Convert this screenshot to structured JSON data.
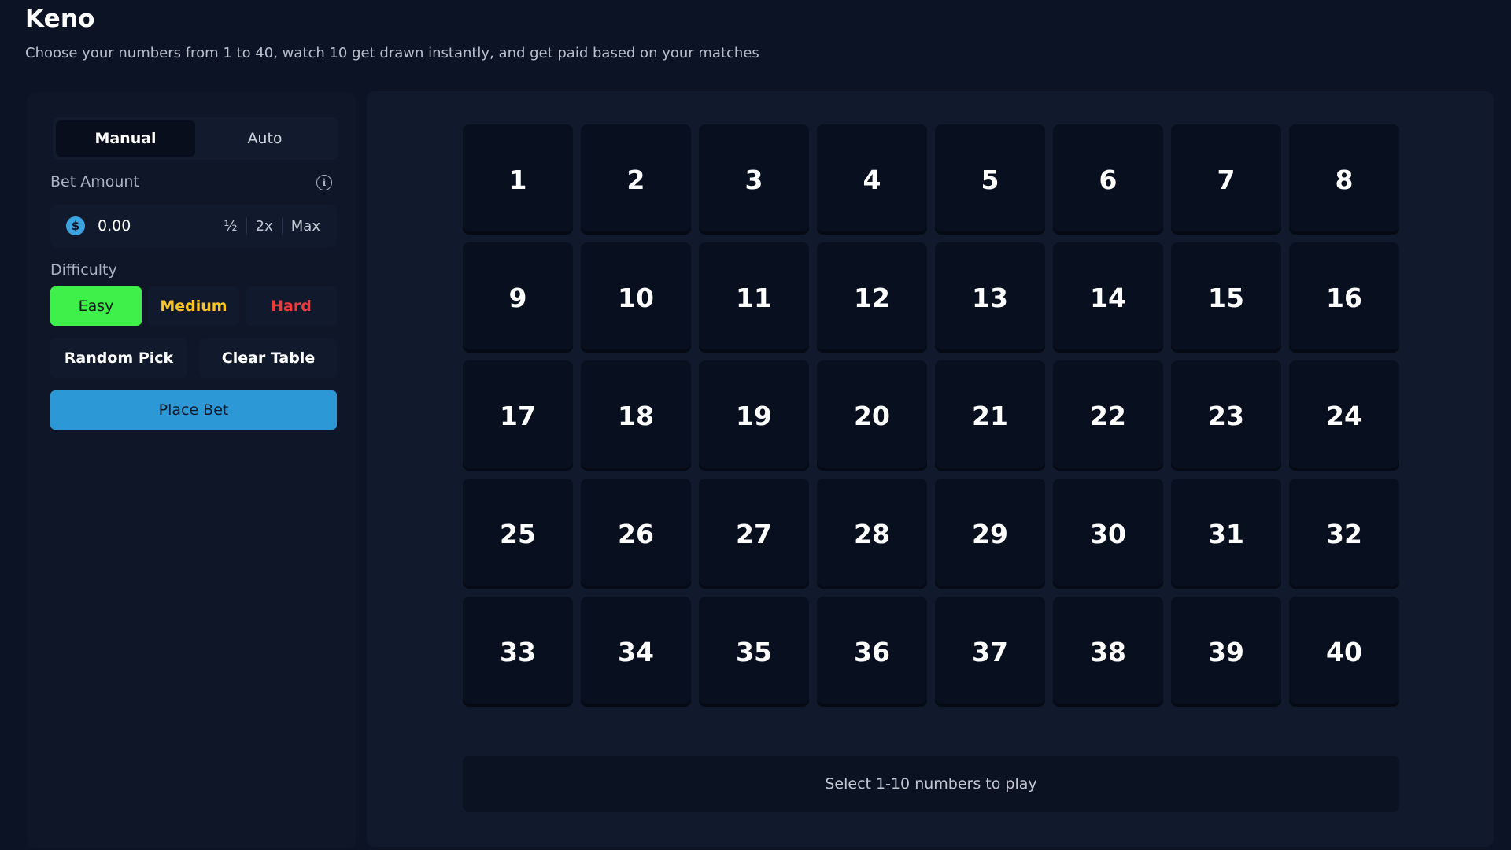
{
  "header": {
    "title": "Keno",
    "subtitle": "Choose your numbers from 1 to 40, watch 10 get drawn instantly, and get paid based on your matches"
  },
  "sidebar": {
    "tabs": [
      {
        "label": "Manual",
        "active": true
      },
      {
        "label": "Auto",
        "active": false
      }
    ],
    "bet_amount": {
      "label": "Bet Amount",
      "info_icon": "info-icon",
      "currency_icon": "coin-icon",
      "value": "0.00",
      "actions": [
        "½",
        "2x",
        "Max"
      ]
    },
    "difficulty": {
      "label": "Difficulty",
      "options": [
        {
          "label": "Easy",
          "selected": true,
          "color": "#3ff04a"
        },
        {
          "label": "Medium",
          "selected": false,
          "color": "#f7c325"
        },
        {
          "label": "Hard",
          "selected": false,
          "color": "#ef3a3a"
        }
      ]
    },
    "random_pick_label": "Random Pick",
    "clear_table_label": "Clear Table",
    "place_bet_label": "Place Bet"
  },
  "board": {
    "numbers": [
      1,
      2,
      3,
      4,
      5,
      6,
      7,
      8,
      9,
      10,
      11,
      12,
      13,
      14,
      15,
      16,
      17,
      18,
      19,
      20,
      21,
      22,
      23,
      24,
      25,
      26,
      27,
      28,
      29,
      30,
      31,
      32,
      33,
      34,
      35,
      36,
      37,
      38,
      39,
      40
    ],
    "status": "Select 1-10 numbers to play"
  },
  "colors": {
    "background": "#0c1324",
    "accent": "#2d98d6",
    "easy": "#3ff04a",
    "medium": "#f7c325",
    "hard": "#ef3a3a"
  }
}
